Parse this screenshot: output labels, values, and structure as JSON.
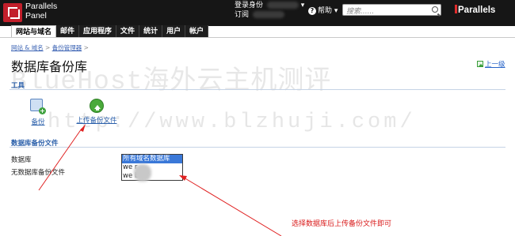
{
  "app": {
    "logo_line1": "Parallels",
    "logo_line2": "Panel",
    "brand": "Parallels"
  },
  "header": {
    "login_label": "登录身份",
    "subscription_label": "订阅",
    "help_label": "帮助",
    "search_placeholder": "搜索......"
  },
  "tabs": [
    {
      "label": "网站与域名",
      "active": true
    },
    {
      "label": "邮件"
    },
    {
      "label": "应用程序"
    },
    {
      "label": "文件"
    },
    {
      "label": "统计"
    },
    {
      "label": "用户"
    },
    {
      "label": "帐户"
    }
  ],
  "breadcrumb": [
    "网站 & 域名",
    "备份管理器"
  ],
  "breadcrumb_sep": ">",
  "page_title": "数据库备份库",
  "up_level": "上一级",
  "tools": {
    "section_title": "工具",
    "backup_label": "备份",
    "upload_label": "上传备份文件"
  },
  "files_section": {
    "title": "数据库备份文件",
    "database_label": "数据库",
    "no_files_label": "无数据库备份文件",
    "options": [
      "所有域名数据库",
      "we    r",
      "we    b"
    ]
  },
  "watermark": {
    "line1": "BlueHost海外云主机测评",
    "line2": "http://www.blzhuji.com/"
  },
  "annotation": "选择数据库后上传备份文件即可",
  "colors": {
    "topbar": "#161616",
    "link": "#2a5faa",
    "annotation": "#d91a1a",
    "selected": "#3a78d8"
  }
}
